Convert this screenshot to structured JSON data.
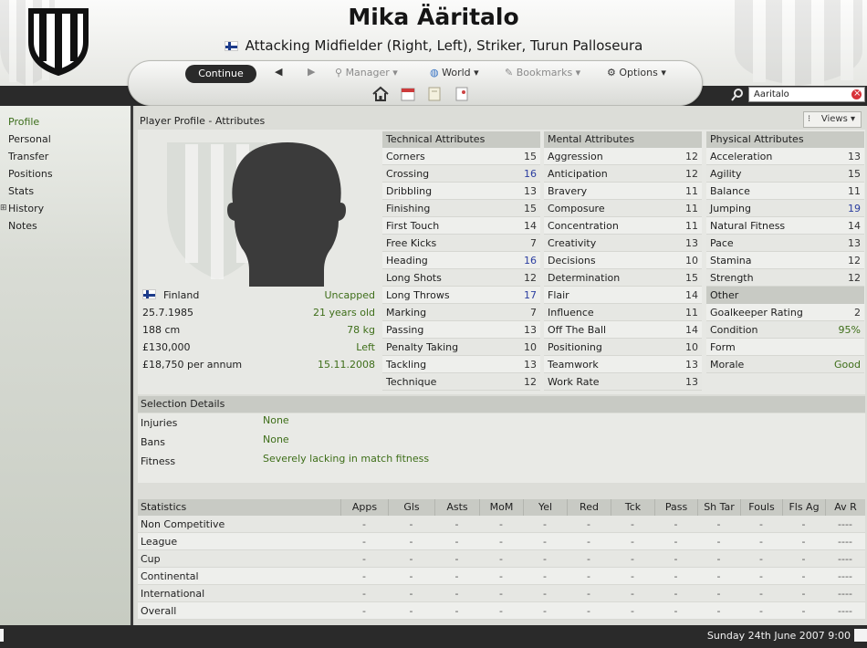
{
  "header": {
    "player_name": "Mika Ääritalo",
    "subtitle": "Attacking Midfielder (Right, Left), Striker, Turun Palloseura"
  },
  "toolbar": {
    "continue": "Continue",
    "back": "◀",
    "forward": "▶",
    "manager": "Manager",
    "world": "World",
    "bookmarks": "Bookmarks",
    "options": "Options"
  },
  "search": {
    "value": "Aaritalo"
  },
  "sidebar": {
    "items": [
      "Profile",
      "Personal",
      "Transfer",
      "Positions",
      "Stats",
      "History",
      "Notes"
    ]
  },
  "main": {
    "title": "Player Profile - Attributes",
    "views": "Views"
  },
  "info": [
    {
      "left": "Finland",
      "right": "Uncapped"
    },
    {
      "left": "25.7.1985",
      "right": "21 years old"
    },
    {
      "left": "188 cm",
      "right": "78 kg"
    },
    {
      "left": "£130,000",
      "right": "Left"
    },
    {
      "left": "£18,750 per annum",
      "right": "15.11.2008"
    }
  ],
  "technical": {
    "title": "Technical Attributes",
    "rows": [
      {
        "name": "Corners",
        "value": "15"
      },
      {
        "name": "Crossing",
        "value": "16"
      },
      {
        "name": "Dribbling",
        "value": "13"
      },
      {
        "name": "Finishing",
        "value": "15"
      },
      {
        "name": "First Touch",
        "value": "14"
      },
      {
        "name": "Free Kicks",
        "value": "7"
      },
      {
        "name": "Heading",
        "value": "16"
      },
      {
        "name": "Long Shots",
        "value": "12"
      },
      {
        "name": "Long Throws",
        "value": "17"
      },
      {
        "name": "Marking",
        "value": "7"
      },
      {
        "name": "Passing",
        "value": "13"
      },
      {
        "name": "Penalty Taking",
        "value": "10"
      },
      {
        "name": "Tackling",
        "value": "13"
      },
      {
        "name": "Technique",
        "value": "12"
      }
    ]
  },
  "mental": {
    "title": "Mental Attributes",
    "rows": [
      {
        "name": "Aggression",
        "value": "12"
      },
      {
        "name": "Anticipation",
        "value": "12"
      },
      {
        "name": "Bravery",
        "value": "11"
      },
      {
        "name": "Composure",
        "value": "11"
      },
      {
        "name": "Concentration",
        "value": "11"
      },
      {
        "name": "Creativity",
        "value": "13"
      },
      {
        "name": "Decisions",
        "value": "10"
      },
      {
        "name": "Determination",
        "value": "15"
      },
      {
        "name": "Flair",
        "value": "14"
      },
      {
        "name": "Influence",
        "value": "11"
      },
      {
        "name": "Off The Ball",
        "value": "14"
      },
      {
        "name": "Positioning",
        "value": "10"
      },
      {
        "name": "Teamwork",
        "value": "13"
      },
      {
        "name": "Work Rate",
        "value": "13"
      }
    ]
  },
  "physical": {
    "title": "Physical Attributes",
    "rows": [
      {
        "name": "Acceleration",
        "value": "13"
      },
      {
        "name": "Agility",
        "value": "15"
      },
      {
        "name": "Balance",
        "value": "11"
      },
      {
        "name": "Jumping",
        "value": "19"
      },
      {
        "name": "Natural Fitness",
        "value": "14"
      },
      {
        "name": "Pace",
        "value": "13"
      },
      {
        "name": "Stamina",
        "value": "12"
      },
      {
        "name": "Strength",
        "value": "12"
      }
    ]
  },
  "other": {
    "title": "Other",
    "rows": [
      {
        "name": "Goalkeeper Rating",
        "value": "2"
      },
      {
        "name": "Condition",
        "value": "95%"
      },
      {
        "name": "Form",
        "value": ""
      },
      {
        "name": "Morale",
        "value": "Good"
      }
    ]
  },
  "selection": {
    "title": "Selection Details",
    "rows": [
      {
        "label": "Injuries",
        "value": "None"
      },
      {
        "label": "Bans",
        "value": "None"
      },
      {
        "label": "Fitness",
        "value": "Severely lacking in match fitness"
      }
    ]
  },
  "statistics": {
    "columns": [
      "Statistics",
      "Apps",
      "Gls",
      "Asts",
      "MoM",
      "Yel",
      "Red",
      "Tck",
      "Pass",
      "Sh Tar",
      "Fouls",
      "Fls Ag",
      "Av R"
    ],
    "rows": [
      {
        "label": "Non Competitive",
        "cells": [
          "-",
          "-",
          "-",
          "-",
          "-",
          "-",
          "-",
          "-",
          "-",
          "-",
          "-",
          "----"
        ]
      },
      {
        "label": "League",
        "cells": [
          "-",
          "-",
          "-",
          "-",
          "-",
          "-",
          "-",
          "-",
          "-",
          "-",
          "-",
          "----"
        ]
      },
      {
        "label": "Cup",
        "cells": [
          "-",
          "-",
          "-",
          "-",
          "-",
          "-",
          "-",
          "-",
          "-",
          "-",
          "-",
          "----"
        ]
      },
      {
        "label": "Continental",
        "cells": [
          "-",
          "-",
          "-",
          "-",
          "-",
          "-",
          "-",
          "-",
          "-",
          "-",
          "-",
          "----"
        ]
      },
      {
        "label": "International",
        "cells": [
          "-",
          "-",
          "-",
          "-",
          "-",
          "-",
          "-",
          "-",
          "-",
          "-",
          "-",
          "----"
        ]
      },
      {
        "label": "Overall",
        "cells": [
          "-",
          "-",
          "-",
          "-",
          "-",
          "-",
          "-",
          "-",
          "-",
          "-",
          "-",
          "----"
        ]
      }
    ]
  },
  "status": {
    "datetime": "Sunday 24th June 2007 9:00"
  }
}
